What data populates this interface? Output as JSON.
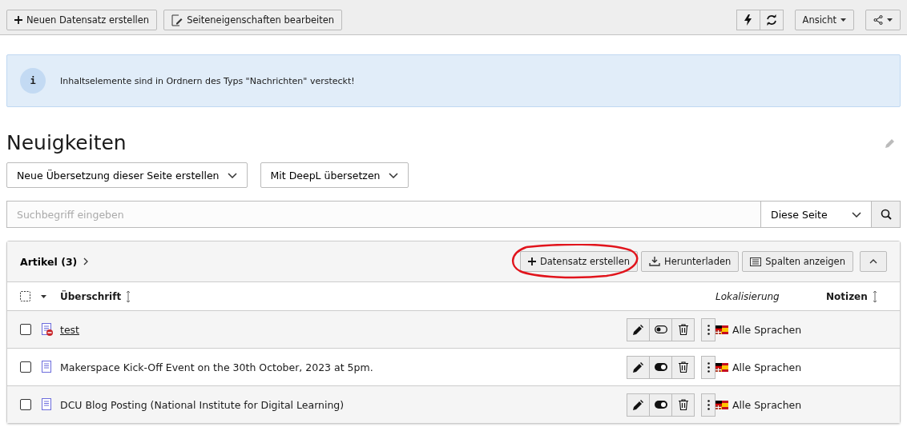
{
  "toolbar": {
    "left_buttons": [
      {
        "kind": "plus",
        "label": "Neuen Datensatz erstellen"
      },
      {
        "kind": "page-edit",
        "label": "Seiteneigenschaften bearbeiten"
      }
    ],
    "view_button": {
      "label": "Ansicht"
    }
  },
  "info": {
    "icon": "i",
    "message": "Inhaltselemente sind in Ordnern des Typs \"Nachrichten\" versteckt!"
  },
  "page_title": "Neuigkeiten",
  "translation_dropdowns": [
    "Neue Übersetzung dieser Seite erstellen",
    "Mit DeepL übersetzen"
  ],
  "search": {
    "placeholder": "Suchbegriff eingeben",
    "scope": "Diese Seite"
  },
  "panel": {
    "title": "Artikel (3)",
    "buttons": [
      {
        "kind": "plus",
        "label": "Datensatz erstellen",
        "annotated": true
      },
      {
        "kind": "download",
        "label": "Herunterladen",
        "annotated": false
      },
      {
        "kind": "columns",
        "label": "Spalten anzeigen",
        "annotated": false
      }
    ],
    "select_all": {
      "checked": false
    },
    "columns": {
      "title": "Überschrift",
      "localization": "Lokalisierung",
      "notes": "Notizen"
    },
    "rows": [
      {
        "title": "test",
        "hidden": true,
        "hovered": true,
        "checked": false,
        "language": "Alle Sprachen"
      },
      {
        "title": "Makerspace Kick-Off Event on the 30th October, 2023 at 5pm.",
        "hidden": false,
        "hovered": false,
        "checked": false,
        "language": "Alle Sprachen"
      },
      {
        "title": "DCU Blog Posting (National Institute for Digital Learning)",
        "hidden": false,
        "hovered": false,
        "checked": false,
        "language": "Alle Sprachen"
      }
    ]
  }
}
